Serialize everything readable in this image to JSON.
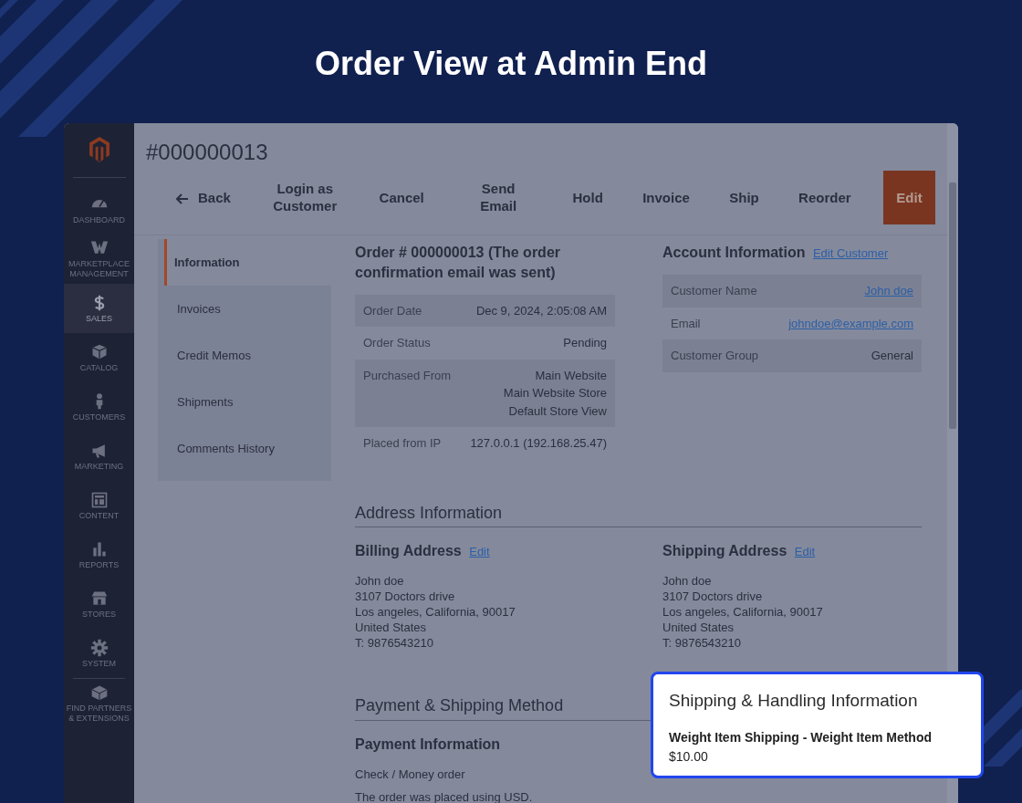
{
  "headline": "Order View at Admin End",
  "sidebar": {
    "items": [
      {
        "label": "DASHBOARD",
        "selected": false
      },
      {
        "label": "MARKETPLACE MANAGEMENT",
        "selected": false
      },
      {
        "label": "SALES",
        "selected": true
      },
      {
        "label": "CATALOG",
        "selected": false
      },
      {
        "label": "CUSTOMERS",
        "selected": false
      },
      {
        "label": "MARKETING",
        "selected": false
      },
      {
        "label": "CONTENT",
        "selected": false
      },
      {
        "label": "REPORTS",
        "selected": false
      },
      {
        "label": "STORES",
        "selected": false
      },
      {
        "label": "SYSTEM",
        "selected": false
      },
      {
        "label": "FIND PARTNERS & EXTENSIONS",
        "selected": false
      }
    ]
  },
  "order_number": "#000000013",
  "actions": [
    {
      "label": "Back",
      "kind": "back"
    },
    {
      "label": "Login as Customer",
      "kind": "plain"
    },
    {
      "label": "Cancel",
      "kind": "plain"
    },
    {
      "label": "Send Email",
      "kind": "plain"
    },
    {
      "label": "Hold",
      "kind": "plain"
    },
    {
      "label": "Invoice",
      "kind": "plain"
    },
    {
      "label": "Ship",
      "kind": "plain"
    },
    {
      "label": "Reorder",
      "kind": "plain"
    },
    {
      "label": "Edit",
      "kind": "primary"
    }
  ],
  "tabs": [
    {
      "label": "Information",
      "selected": true
    },
    {
      "label": "Invoices",
      "selected": false
    },
    {
      "label": "Credit Memos",
      "selected": false
    },
    {
      "label": "Shipments",
      "selected": false
    },
    {
      "label": "Comments History",
      "selected": false
    }
  ],
  "order_info": {
    "title": "Order # 000000013 (The order confirmation email was sent)",
    "rows": [
      {
        "label": "Order Date",
        "value": [
          "Dec 9, 2024, 2:05:08 AM"
        ]
      },
      {
        "label": "Order Status",
        "value": [
          "Pending"
        ]
      },
      {
        "label": "Purchased From",
        "value": [
          "Main Website",
          "Main Website Store",
          "Default Store View"
        ]
      },
      {
        "label": "Placed from IP",
        "value": [
          "127.0.0.1 (192.168.25.47)"
        ]
      }
    ]
  },
  "account_info": {
    "title": "Account Information",
    "edit_link": "Edit Customer",
    "rows": [
      {
        "label": "Customer Name",
        "value": "John doe",
        "link": true
      },
      {
        "label": "Email",
        "value": "johndoe@example.com",
        "link": true
      },
      {
        "label": "Customer Group",
        "value": "General",
        "link": false
      }
    ]
  },
  "address_info": {
    "heading": "Address Information",
    "addresses": [
      {
        "title": "Billing Address",
        "edit_link": "Edit",
        "lines": [
          "John doe",
          "3107 Doctors drive",
          "Los angeles, California, 90017",
          "United States",
          "T: 9876543210"
        ]
      },
      {
        "title": "Shipping Address",
        "edit_link": "Edit",
        "lines": [
          "John doe",
          "3107 Doctors drive",
          "Los angeles, California, 90017",
          "United States",
          "T: 9876543210"
        ]
      }
    ]
  },
  "payment_shipping": {
    "heading": "Payment & Shipping Method",
    "payment_title": "Payment Information",
    "lines": [
      "Check / Money order",
      "The order was placed using USD."
    ]
  },
  "callout": {
    "title": "Shipping & Handling Information",
    "method": "Weight Item Shipping - Weight Item Method",
    "price": "$10.00"
  }
}
